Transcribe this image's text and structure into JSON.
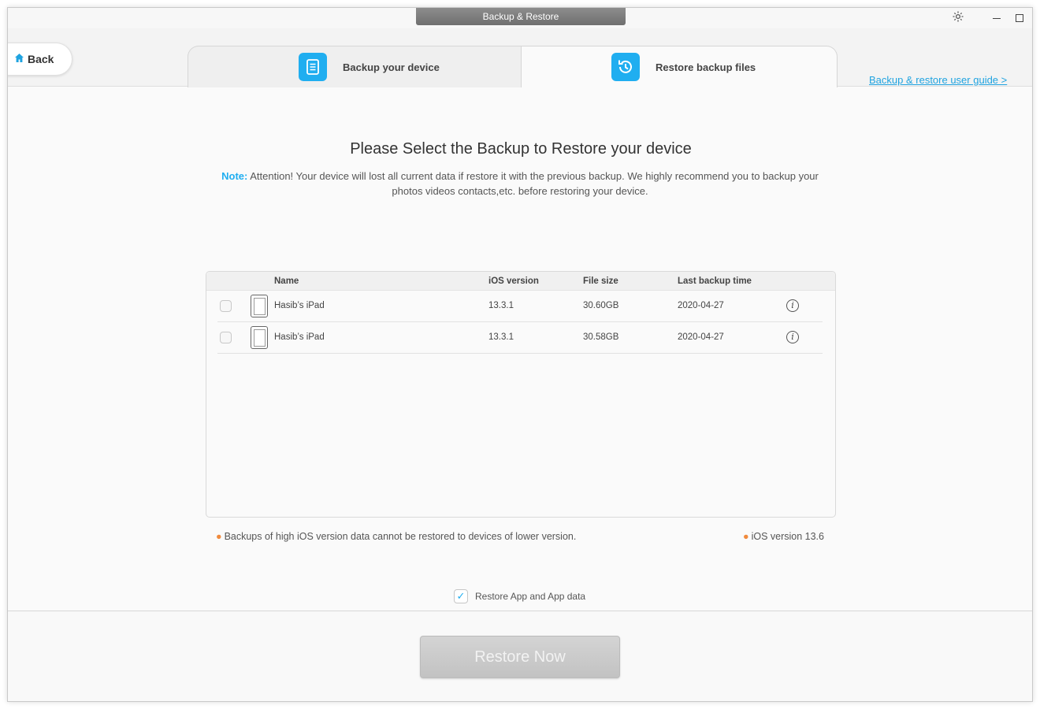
{
  "window": {
    "title": "Backup & Restore"
  },
  "header": {
    "back_label": "Back",
    "tabs": [
      {
        "label": "Backup your device",
        "icon": "document-icon"
      },
      {
        "label": "Restore backup files",
        "icon": "clock-restore-icon"
      }
    ],
    "guide_link": "Backup & restore user guide >"
  },
  "main": {
    "title": "Please Select the Backup to Restore your device",
    "note_label": "Note:",
    "note_text": "Attention! Your device will lost all current data if restore it with the previous backup. We highly recommend you to backup your photos videos contacts,etc. before restoring your device."
  },
  "table": {
    "columns": {
      "name": "Name",
      "ios": "iOS version",
      "size": "File size",
      "time": "Last backup time"
    },
    "rows": [
      {
        "name": "Hasib’s iPad",
        "ios": "13.3.1",
        "size": "30.60GB",
        "time": "2020-04-27",
        "checked": false
      },
      {
        "name": "Hasib’s iPad",
        "ios": "13.3.1",
        "size": "30.58GB",
        "time": "2020-04-27",
        "checked": false
      }
    ]
  },
  "footnotes": {
    "left": "Backups of high iOS version data cannot be restored to devices of lower version.",
    "right": "iOS version 13.6"
  },
  "options": {
    "restore_app_label": "Restore App and App data",
    "restore_app_checked": true
  },
  "actions": {
    "restore_now": "Restore Now"
  },
  "colors": {
    "accent": "#20aef0",
    "bullet": "#f08a3c",
    "button_disabled": "#c8c8c8"
  }
}
